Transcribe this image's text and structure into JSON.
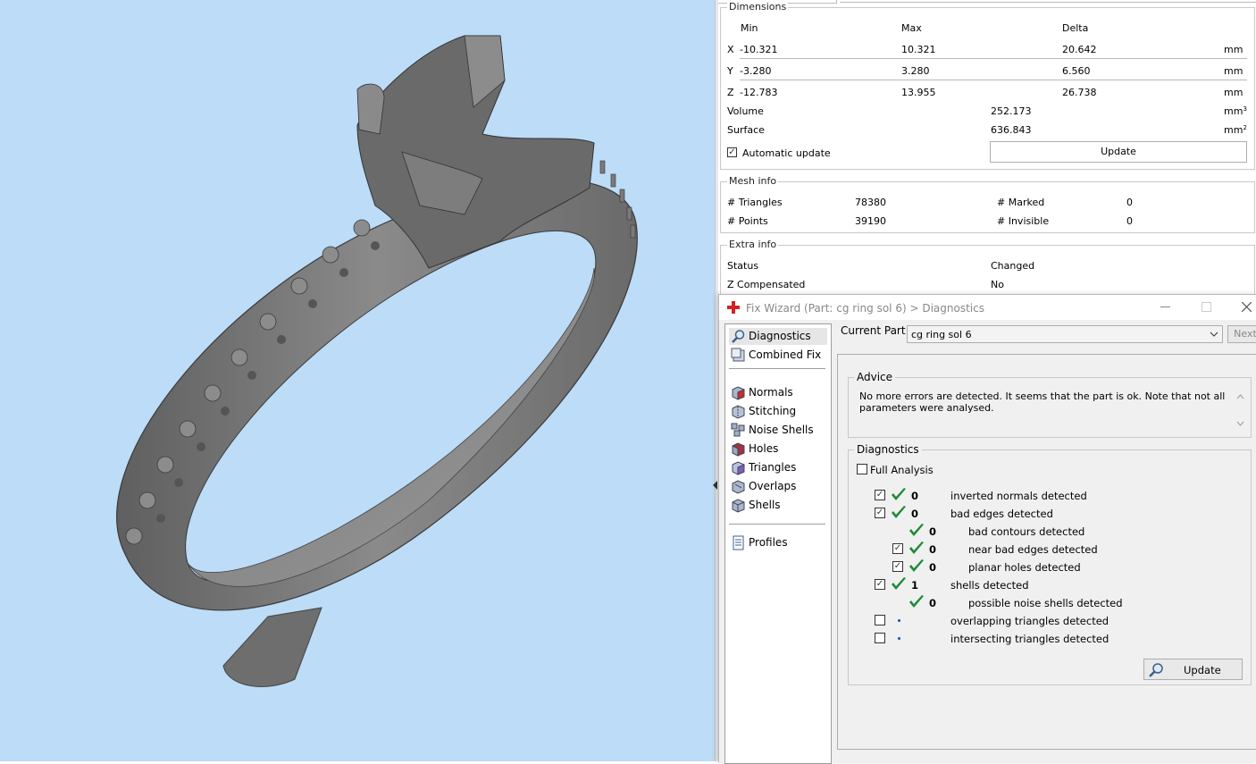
{
  "dimensions": {
    "title": "Dimensions",
    "headers": {
      "min": "Min",
      "max": "Max",
      "delta": "Delta"
    },
    "rows": [
      {
        "axis": "X",
        "min": "-10.321",
        "max": "10.321",
        "delta": "20.642",
        "unit": "mm"
      },
      {
        "axis": "Y",
        "min": "-3.280",
        "max": "3.280",
        "delta": "6.560",
        "unit": "mm"
      },
      {
        "axis": "Z",
        "min": "-12.783",
        "max": "13.955",
        "delta": "26.738",
        "unit": "mm"
      }
    ],
    "volume_label": "Volume",
    "volume_value": "252.173",
    "volume_unit": "mm",
    "volume_unit_sup": "3",
    "surface_label": "Surface",
    "surface_value": "636.843",
    "surface_unit": "mm",
    "surface_unit_sup": "2",
    "auto_update_label": "Automatic update",
    "auto_update_checked": true,
    "update_button": "Update"
  },
  "mesh_info": {
    "title": "Mesh info",
    "triangles_label": "# Triangles",
    "triangles_value": "78380",
    "points_label": "# Points",
    "points_value": "39190",
    "marked_label": "# Marked",
    "marked_value": "0",
    "invisible_label": "# Invisible",
    "invisible_value": "0"
  },
  "extra_info": {
    "title": "Extra info",
    "status_label": "Status",
    "status_value": "Changed",
    "zcomp_label": "Z Compensated",
    "zcomp_value": "No"
  },
  "fix_wizard": {
    "title": "Fix Wizard (Part: cg ring sol 6) > Diagnostics",
    "nav": [
      {
        "label": "Diagnostics",
        "icon": "magnifier-icon",
        "selected": true
      },
      {
        "label": "Combined Fix",
        "icon": "combined-fix-icon"
      },
      {
        "label": "Normals",
        "icon": "normals-cube-icon"
      },
      {
        "label": "Stitching",
        "icon": "stitching-cube-icon"
      },
      {
        "label": "Noise Shells",
        "icon": "noise-shells-icon"
      },
      {
        "label": "Holes",
        "icon": "holes-cube-icon"
      },
      {
        "label": "Triangles",
        "icon": "triangles-cube-icon"
      },
      {
        "label": "Overlaps",
        "icon": "overlaps-cube-icon"
      },
      {
        "label": "Shells",
        "icon": "shells-cube-icon"
      },
      {
        "label": "Profiles",
        "icon": "profiles-page-icon"
      }
    ],
    "current_part_label": "Current Part:",
    "current_part_value": "cg ring sol 6",
    "next_button": "Next",
    "advice_title": "Advice",
    "advice_text": "No more errors are detected. It seems that the part is ok. Note that not all parameters were analysed.",
    "diagnostics_title": "Diagnostics",
    "full_analysis_label": "Full Analysis",
    "full_analysis_checked": false,
    "items": [
      {
        "label": "inverted normals detected",
        "count": "0",
        "checked": true,
        "has_checkbox": true,
        "status": "ok",
        "indent": 0
      },
      {
        "label": "bad edges detected",
        "count": "0",
        "checked": true,
        "has_checkbox": true,
        "status": "ok",
        "indent": 0
      },
      {
        "label": "bad contours detected",
        "count": "0",
        "checked": false,
        "has_checkbox": false,
        "status": "ok",
        "indent": 1
      },
      {
        "label": "near bad edges detected",
        "count": "0",
        "checked": true,
        "has_checkbox": true,
        "status": "ok",
        "indent": 1
      },
      {
        "label": "planar holes detected",
        "count": "0",
        "checked": true,
        "has_checkbox": true,
        "status": "ok",
        "indent": 1
      },
      {
        "label": "shells detected",
        "count": "1",
        "checked": true,
        "has_checkbox": true,
        "status": "ok",
        "indent": 0
      },
      {
        "label": "possible noise shells detected",
        "count": "0",
        "checked": false,
        "has_checkbox": false,
        "status": "ok",
        "indent": 1
      },
      {
        "label": "overlapping triangles detected",
        "count": "",
        "checked": false,
        "has_checkbox": true,
        "status": "pending",
        "indent": 0
      },
      {
        "label": "intersecting triangles detected",
        "count": "",
        "checked": false,
        "has_checkbox": true,
        "status": "pending",
        "indent": 0
      }
    ],
    "update_button": "Update"
  },
  "colors": {
    "viewport_bg": "#bcdcf7",
    "ok_check": "#1f8a3a",
    "pending_dot": "#1a4bb8"
  }
}
